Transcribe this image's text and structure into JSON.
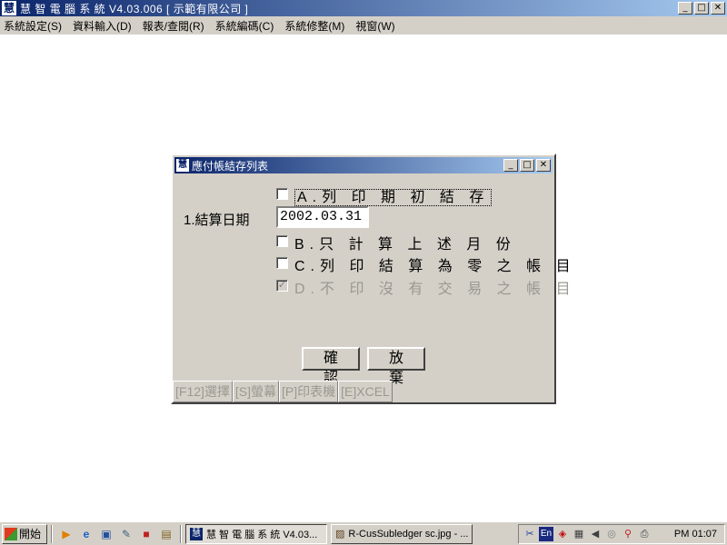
{
  "app": {
    "icon_glyph": "慧",
    "title": "慧 智 電 腦 系 統 V4.03.006 [ 示範有限公司 ]"
  },
  "window_buttons": {
    "minimize": "_",
    "maximize": "□",
    "close": "✕"
  },
  "menu": [
    "系統設定(S)",
    "資料輸入(D)",
    "報表/查閱(R)",
    "系統編碼(C)",
    "系統修整(M)",
    "視窗(W)"
  ],
  "dialog": {
    "icon_glyph": "慧",
    "title": "應付帳結存列表",
    "date_label": "1.結算日期",
    "date_value": "2002.03.31",
    "options": [
      {
        "label": "A.列 印 期 初 結 存",
        "checked": false,
        "disabled": false,
        "focused": true
      },
      {
        "label": "B.只 計 算 上 述 月 份",
        "checked": false,
        "disabled": false,
        "focused": false
      },
      {
        "label": "C.列 印 結 算 為 零 之 帳 目",
        "checked": false,
        "disabled": false,
        "focused": false
      },
      {
        "label": "D.不 印 沒 有 交 易 之 帳 目",
        "checked": true,
        "disabled": true,
        "focused": false
      }
    ],
    "confirm_label": "確 認",
    "cancel_label": "放 棄",
    "function_keys": [
      "[F12]選擇",
      "[S]螢幕",
      "[P]印表機",
      "[E]XCEL"
    ]
  },
  "taskbar": {
    "start_label": "開始",
    "quick_launch_icons": [
      "media-player-icon",
      "ie-icon",
      "desktop-icon",
      "notepad-icon",
      "app-icon",
      "folder-icon"
    ],
    "tasks": [
      {
        "label": "慧 智 電 腦 系 統 V4.03...",
        "active": true
      },
      {
        "label": "R-CusSubledger sc.jpg - ...",
        "active": false
      }
    ],
    "tray_icons": [
      "ime-icon",
      "en-lang-icon",
      "shield-icon",
      "network-icon",
      "volume-icon",
      "app-tray-icon",
      "search-tray-icon",
      "printer-icon"
    ],
    "en_label": "En",
    "clock": "PM 01:07"
  }
}
